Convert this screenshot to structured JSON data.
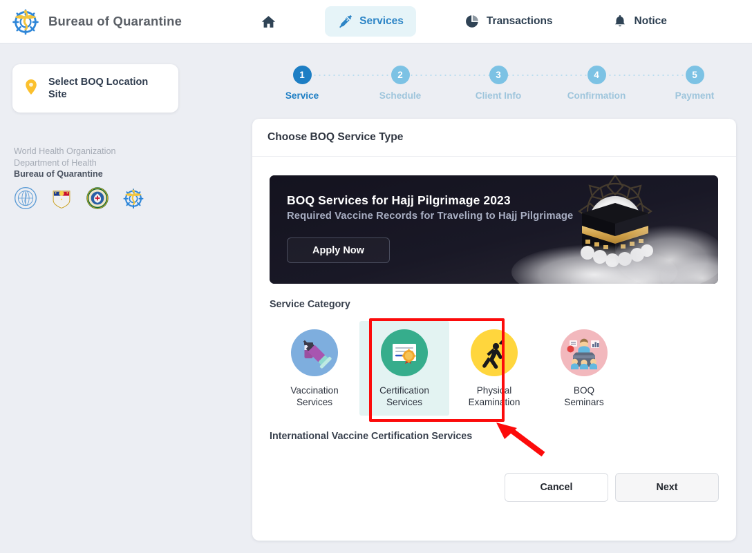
{
  "header": {
    "brand_title": "Bureau of Quarantine",
    "brand_logo_icon": "boq-caduceus-wheel-logo",
    "nav": [
      {
        "label": "",
        "icon": "home-icon",
        "active": false,
        "name": "home"
      },
      {
        "label": "Services",
        "icon": "syringe-icon",
        "active": true,
        "name": "services"
      },
      {
        "label": "Transactions",
        "icon": "pie-chart-icon",
        "active": false,
        "name": "transactions"
      },
      {
        "label": "Notice",
        "icon": "bell-icon",
        "active": false,
        "name": "notice"
      }
    ]
  },
  "sidebar": {
    "location_button": {
      "label_line1": "Select BOQ Location",
      "label_line2": "Site",
      "icon": "map-pin-icon"
    },
    "org_lines": {
      "line1": "World Health Organization",
      "line2": "Department of Health",
      "line3": "Bureau of Quarantine"
    },
    "seals": [
      {
        "name": "who-seal"
      },
      {
        "name": "philippines-coat-of-arms-seal"
      },
      {
        "name": "department-of-health-seal"
      },
      {
        "name": "bureau-of-quarantine-seal"
      }
    ]
  },
  "stepper": {
    "steps": [
      {
        "number": "1",
        "label": "Service",
        "active": true
      },
      {
        "number": "2",
        "label": "Schedule",
        "active": false
      },
      {
        "number": "3",
        "label": "Client Info",
        "active": false
      },
      {
        "number": "4",
        "label": "Confirmation",
        "active": false
      },
      {
        "number": "5",
        "label": "Payment",
        "active": false
      }
    ]
  },
  "panel": {
    "title": "Choose BOQ Service Type",
    "banner": {
      "heading": "BOQ Services for Hajj Pilgrimage 2023",
      "subheading": "Required Vaccine Records for Traveling to Hajj Pilgrimage",
      "button_label": "Apply Now",
      "art": "kaaba-moon-clouds-illustration"
    },
    "service_category_label": "Service Category",
    "categories": [
      {
        "name_line1": "Vaccination",
        "name_line2": "Services",
        "icon": "vaccine-syringe-vial-icon",
        "circle_color": "#7eaede",
        "selected": false
      },
      {
        "name_line1": "Certification",
        "name_line2": "Services",
        "icon": "certificate-award-icon",
        "circle_color": "#36ad8c",
        "selected": true
      },
      {
        "name_line1": "Physical",
        "name_line2": "Examination",
        "icon": "stretching-person-icon",
        "circle_color": "#ffd63d",
        "selected": false
      },
      {
        "name_line1": "BOQ",
        "name_line2": "Seminars",
        "icon": "speaker-podium-icon",
        "circle_color": "#f2b8bd",
        "selected": false
      }
    ],
    "selected_service_note": "International Vaccine Certification Services",
    "cancel_label": "Cancel",
    "next_label": "Next"
  },
  "annotation": {
    "highlight_color": "#fc0b0b",
    "target": "certification-services-category"
  }
}
